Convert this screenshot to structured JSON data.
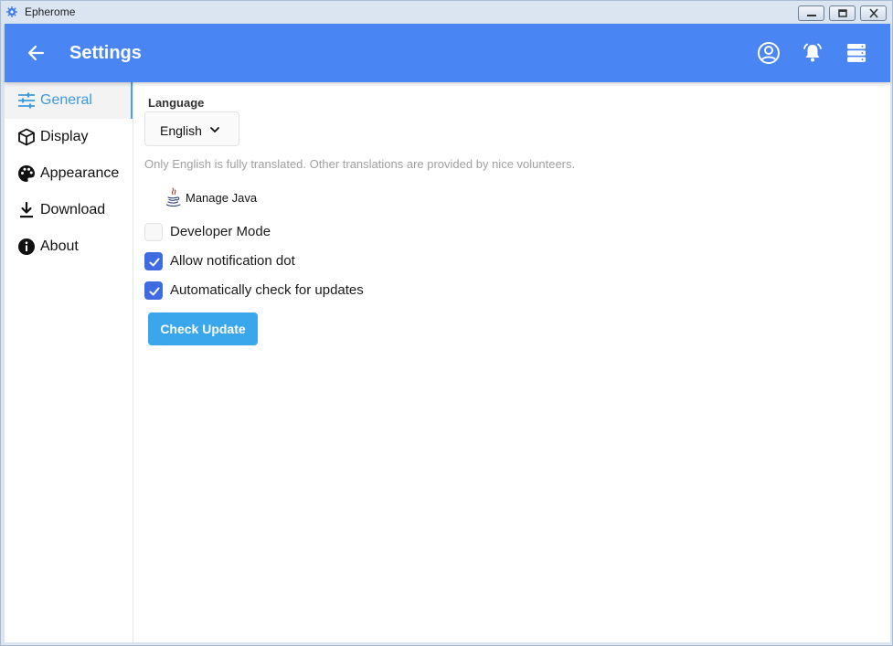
{
  "window": {
    "title": "Epherome"
  },
  "appbar": {
    "title": "Settings",
    "icons": [
      "back-arrow-icon",
      "account-icon",
      "bell-icon",
      "server-icon"
    ]
  },
  "sidebar": {
    "items": [
      {
        "label": "General",
        "icon": "tune-icon",
        "active": true
      },
      {
        "label": "Display",
        "icon": "cube-icon",
        "active": false
      },
      {
        "label": "Appearance",
        "icon": "palette-icon",
        "active": false
      },
      {
        "label": "Download",
        "icon": "download-icon",
        "active": false
      },
      {
        "label": "About",
        "icon": "info-icon",
        "active": false
      }
    ]
  },
  "general": {
    "language_heading": "Language",
    "language_value": "English",
    "language_hint": "Only English is fully translated. Other translations are provided by nice volunteers.",
    "manage_java_label": "Manage Java",
    "options": [
      {
        "label": "Developer Mode",
        "checked": false
      },
      {
        "label": "Allow notification dot",
        "checked": true
      },
      {
        "label": "Automatically check for updates",
        "checked": true
      }
    ],
    "check_update_label": "Check Update"
  },
  "colors": {
    "appbar": "#4a86f3",
    "accent": "#3d9ae0",
    "checkbox": "#3f6be0",
    "button": "#3aa6ec"
  }
}
